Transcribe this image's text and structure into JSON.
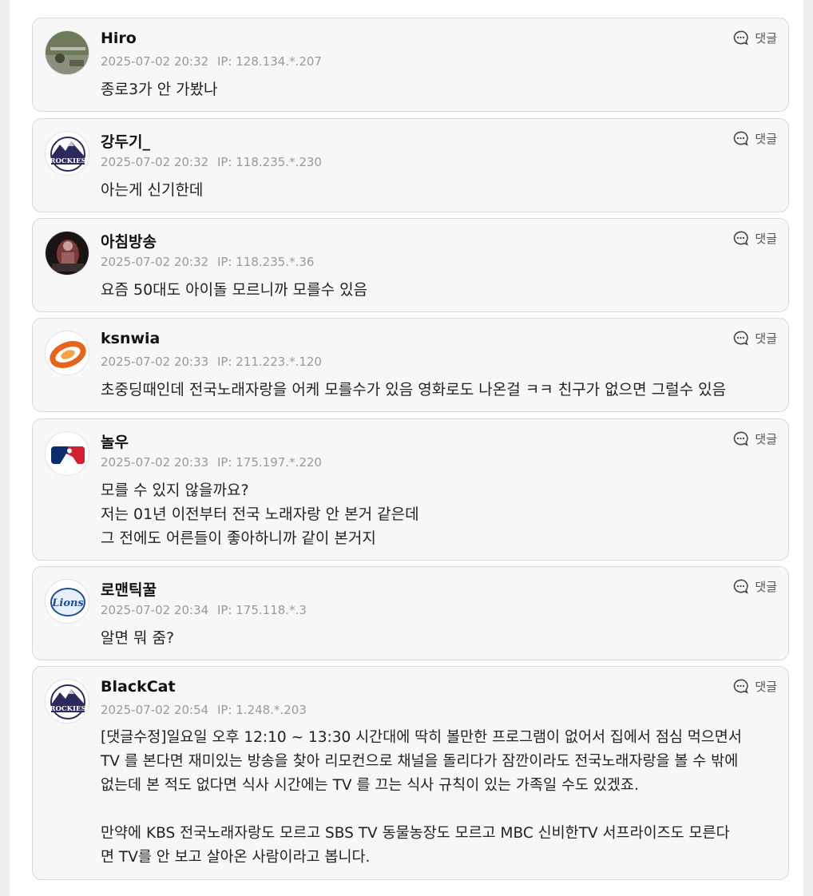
{
  "reply_label": "댓글",
  "ip_prefix": "IP:",
  "comments": [
    {
      "nickname": "Hiro",
      "datetime": "2025-07-02 20:32",
      "ip": "128.134.*.207",
      "avatar": "photo-avatar",
      "lines": [
        "종로3가 안 가봤나"
      ]
    },
    {
      "nickname": "강두기_",
      "datetime": "2025-07-02 20:32",
      "ip": "118.235.*.230",
      "avatar": "rockies-logo",
      "avatar_text": "ROCKIES",
      "lines": [
        "아는게 신기한데"
      ]
    },
    {
      "nickname": "아침방송",
      "datetime": "2025-07-02 20:32",
      "ip": "118.235.*.36",
      "avatar": "photo-avatar",
      "lines": [
        "요즘 50대도 아이돌 모르니까 모를수 있음"
      ]
    },
    {
      "nickname": "ksnwia",
      "datetime": "2025-07-02 20:33",
      "ip": "211.223.*.120",
      "avatar": "orange-ring-logo",
      "lines": [
        "초중딩때인데 전국노래자랑을 어케 모를수가 있음 영화로도 나온걸 ㅋㅋ 친구가 없으면 그럴수 있음"
      ]
    },
    {
      "nickname": "놀우",
      "datetime": "2025-07-02 20:33",
      "ip": "175.197.*.220",
      "avatar": "mlb-logo",
      "lines": [
        "모를 수 있지 않을까요?",
        "저는 01년 이전부터 전국 노래자랑 안 본거 같은데",
        "그 전에도 어른들이 좋아하니까 같이 본거지"
      ]
    },
    {
      "nickname": "로맨틱꿀",
      "datetime": "2025-07-02 20:34",
      "ip": "175.118.*.3",
      "avatar": "lions-logo",
      "avatar_text": "Lions",
      "lines": [
        "알면 뭐 줌?"
      ]
    },
    {
      "nickname": "BlackCat",
      "datetime": "2025-07-02 20:54",
      "ip": "1.248.*.203",
      "avatar": "rockies-logo",
      "avatar_text": "ROCKIES",
      "lines": [
        "[댓글수정]일요일 오후 12:10 ~ 13:30 시간대에 딱히 볼만한 프로그램이 없어서 집에서 점심 먹으면서",
        "TV 를 본다면 재미있는 방송을 찾아 리모컨으로 채널을 돌리다가 잠깐이라도 전국노래자랑을 볼 수 밖에",
        "없는데 본 적도 없다면 식사 시간에는 TV 를 끄는 식사 규칙이 있는 가족일 수도 있겠죠.",
        "",
        "만약에 KBS 전국노래자랑도 모르고 SBS TV 동물농장도 모르고 MBC 신비한TV 서프라이즈도 모른다",
        "면 TV를 안 보고 살아온 사람이라고 봅니다."
      ]
    }
  ]
}
